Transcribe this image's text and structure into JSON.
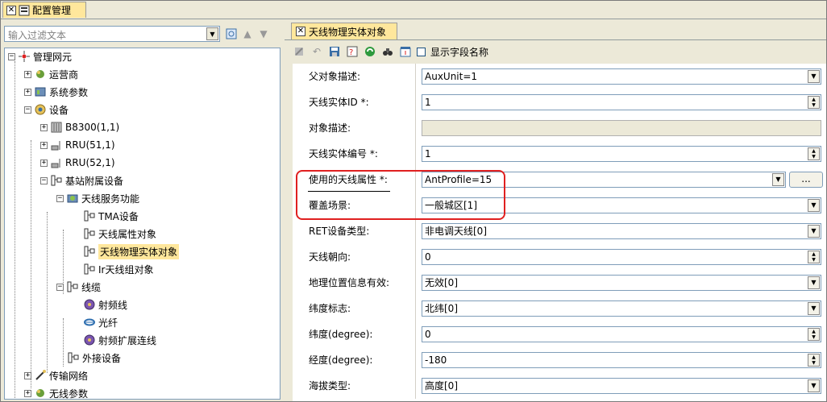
{
  "main_tab": {
    "title": "配置管理"
  },
  "filter": {
    "placeholder": "输入过滤文本"
  },
  "tree": {
    "root": "管理网元",
    "items": [
      {
        "label": "运营商"
      },
      {
        "label": "系统参数"
      },
      {
        "label": "设备"
      },
      {
        "label": "B8300(1,1)"
      },
      {
        "label": "RRU(51,1)"
      },
      {
        "label": "RRU(52,1)"
      },
      {
        "label": "基站附属设备"
      },
      {
        "label": "天线服务功能"
      },
      {
        "label": "TMA设备"
      },
      {
        "label": "天线属性对象"
      },
      {
        "label": "天线物理实体对象"
      },
      {
        "label": "Ir天线组对象"
      },
      {
        "label": "线缆"
      },
      {
        "label": "射频线"
      },
      {
        "label": "光纤"
      },
      {
        "label": "射频扩展连线"
      },
      {
        "label": "外接设备"
      },
      {
        "label": "传输网络"
      },
      {
        "label": "无线参数"
      }
    ]
  },
  "detail_tab": {
    "title": "天线物理实体对象"
  },
  "toolbar": {
    "show_field_names": "显示字段名称"
  },
  "form": {
    "rows": [
      {
        "label": "父对象描述:",
        "value": "AuxUnit=1"
      },
      {
        "label": "天线实体ID *:",
        "value": "1"
      },
      {
        "label": "对象描述:",
        "value": ""
      },
      {
        "label": "天线实体编号 *:",
        "value": "1"
      },
      {
        "label": "使用的天线属性 *:",
        "value": "AntProfile=15",
        "extra": "..."
      },
      {
        "label": "覆盖场景:",
        "value": "一般城区[1]"
      },
      {
        "label": "RET设备类型:",
        "value": "非电调天线[0]"
      },
      {
        "label": "天线朝向:",
        "value": "0"
      },
      {
        "label": "地理位置信息有效:",
        "value": "无效[0]"
      },
      {
        "label": "纬度标志:",
        "value": "北纬[0]"
      },
      {
        "label": "纬度(degree):",
        "value": "0"
      },
      {
        "label": "经度(degree):",
        "value": "-180"
      },
      {
        "label": "海拔类型:",
        "value": "高度[0]"
      }
    ]
  },
  "colors": {
    "tab_active": "#ffe79c",
    "highlight": "#e02020",
    "window_bg": "#ece9d8"
  }
}
